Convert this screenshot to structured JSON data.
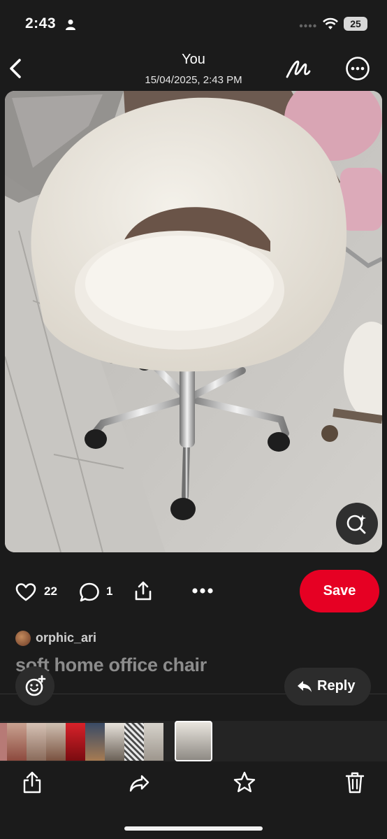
{
  "status_bar": {
    "time": "2:43",
    "battery": "25"
  },
  "header": {
    "title": "You",
    "subtitle": "15/04/2025, 2:43 PM"
  },
  "pin": {
    "likes": "22",
    "comments": "1",
    "save_label": "Save",
    "author": "orphic_ari",
    "title": "soft home office chair",
    "reply_label": "Reply"
  },
  "icons": {
    "back": "chevron-left-icon",
    "markup": "markup-pen-icon",
    "more": "ellipsis-circle-icon",
    "visual_search": "visual-search-icon",
    "like": "heart-icon",
    "comment": "comment-bubble-icon",
    "share": "share-upload-icon",
    "options": "ellipsis-icon",
    "emoji": "emoji-add-icon",
    "reply": "reply-arrow-icon",
    "toolbar": [
      "share-icon",
      "forward-icon",
      "star-icon",
      "trash-icon"
    ]
  },
  "colors": {
    "background": "#1b1b1b",
    "save_button": "#e60023",
    "pin_title": "#8c8c8c"
  }
}
